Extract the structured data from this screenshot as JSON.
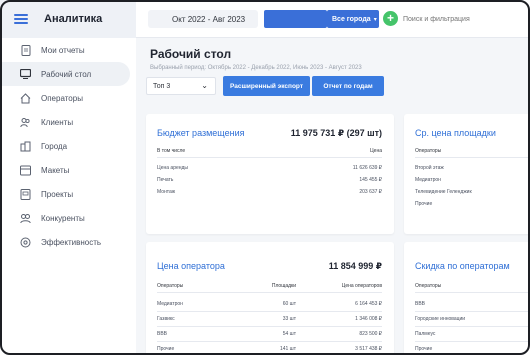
{
  "app": {
    "title": "Аналитика"
  },
  "topbar": {
    "date_range": "Окт 2022 - Авг 2023",
    "city_select": "Все города",
    "search_placeholder": "Поиск и фильтрация",
    "accent": "#3a6fd8",
    "add_color": "#45c46a"
  },
  "sidebar": {
    "items": [
      {
        "label": "Мои отчеты",
        "icon": "document-icon"
      },
      {
        "label": "Рабочий стол",
        "icon": "monitor-icon",
        "active": true
      },
      {
        "label": "Операторы",
        "icon": "home-icon"
      },
      {
        "label": "Клиенты",
        "icon": "users-icon"
      },
      {
        "label": "Города",
        "icon": "city-icon"
      },
      {
        "label": "Макеты",
        "icon": "layout-icon"
      },
      {
        "label": "Проекты",
        "icon": "project-icon"
      },
      {
        "label": "Конкуренты",
        "icon": "competitors-icon"
      },
      {
        "label": "Эффективность",
        "icon": "target-icon"
      }
    ]
  },
  "main": {
    "title": "Рабочий стол",
    "period_text": "Выбранный период: Октябрь 2022 - Декабрь 2022, Июнь 2023 - Август 2023",
    "top_select": "Топ 3",
    "export_button": "Расширенный экспорт",
    "years_button": "Отчет по годам"
  },
  "cards": {
    "budget": {
      "title": "Бюджет размещения",
      "total": "11 975 731 ₽ (297 шт)",
      "col1": "В том числе",
      "col2": "Цена",
      "rows": [
        {
          "name": "Цена аренды",
          "value": "11 626 639 ₽"
        },
        {
          "name": "Печать",
          "value": "145 455 ₽"
        },
        {
          "name": "Монтаж",
          "value": "203 637 ₽"
        }
      ]
    },
    "avg_price": {
      "title": "Ср. цена площадки",
      "col1": "Операторы",
      "rows": [
        {
          "name": "Второй этаж"
        },
        {
          "name": "Медиатрон"
        },
        {
          "name": "Телевидение Геленджик"
        },
        {
          "name": "Прочие"
        }
      ]
    },
    "operator_price": {
      "title": "Цена оператора",
      "total": "11 854 999 ₽",
      "col1": "Операторы",
      "col2": "Площадки",
      "col3": "Цена операторов",
      "rows": [
        {
          "name": "Медиатрон",
          "count": "60 шт",
          "value": "6 164 453 ₽"
        },
        {
          "name": "Газвикс",
          "count": "33 шт",
          "value": "1 346 008 ₽"
        },
        {
          "name": "BBB",
          "count": "54 шт",
          "value": "823 500 ₽"
        },
        {
          "name": "Прочие",
          "count": "141 шт",
          "value": "3 517 438 ₽"
        }
      ]
    },
    "discount": {
      "title": "Скидка по операторам",
      "col1": "Операторы",
      "rows": [
        {
          "name": "BBB"
        },
        {
          "name": "Городские инновации"
        },
        {
          "name": "Палмеус"
        },
        {
          "name": "Прочие"
        }
      ]
    }
  }
}
